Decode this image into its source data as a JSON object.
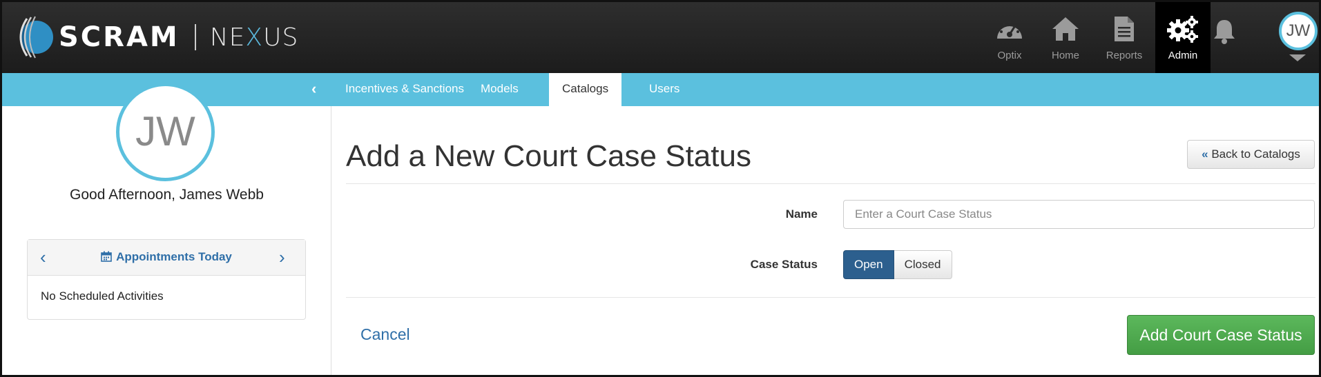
{
  "brand": {
    "name": "SCRAM",
    "product_prefix": "NE",
    "product_x": "X",
    "product_suffix": "US"
  },
  "nav": {
    "items": [
      {
        "label": "Optix",
        "icon": "speedometer-icon"
      },
      {
        "label": "Home",
        "icon": "home-icon"
      },
      {
        "label": "Reports",
        "icon": "document-icon"
      },
      {
        "label": "Admin",
        "icon": "gears-icon",
        "active": true
      }
    ],
    "notifications_icon": "bell-icon",
    "user_initials": "JW"
  },
  "sidebar": {
    "initials": "JW",
    "greeting": "Good Afternoon, James Webb",
    "appointments": {
      "title": "Appointments Today",
      "empty_text": "No Scheduled Activities"
    }
  },
  "tabs": [
    {
      "label": "Incentives & Sanctions"
    },
    {
      "label": "Models"
    },
    {
      "label": "Catalogs",
      "active": true
    },
    {
      "label": "Users"
    }
  ],
  "main": {
    "title": "Add a New Court Case Status",
    "back_button": "Back to Catalogs",
    "form": {
      "name_label": "Name",
      "name_placeholder": "Enter a Court Case Status",
      "name_value": "",
      "status_label": "Case Status",
      "status_options": [
        "Open",
        "Closed"
      ],
      "status_selected": "Open"
    },
    "cancel_label": "Cancel",
    "submit_label": "Add Court Case Status"
  },
  "colors": {
    "accent": "#5bc0de",
    "primary": "#2c5f8e",
    "success": "#5cb85c",
    "link": "#2f6fa8",
    "header": "#222222"
  }
}
